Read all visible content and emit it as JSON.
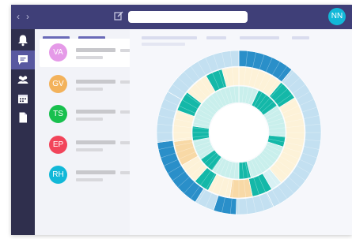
{
  "user": {
    "initials": "NN"
  },
  "chats": [
    {
      "initials": "VA",
      "color": "#e59ae8",
      "selected": true
    },
    {
      "initials": "GV",
      "color": "#f3b25b",
      "selected": false
    },
    {
      "initials": "TS",
      "color": "#18c04e",
      "selected": false
    },
    {
      "initials": "EP",
      "color": "#f2445a",
      "selected": false
    },
    {
      "initials": "RH",
      "color": "#12b8d8",
      "selected": false
    }
  ],
  "chart_data": {
    "type": "sunburst",
    "colors": {
      "dark_blue": "#2a8fc9",
      "light_blue": "#c3e0f1",
      "teal": "#14b8a8",
      "pale_teal": "#c9efec",
      "cream": "#fdf2d8",
      "gold": "#f8d9a6",
      "pale_cyan": "#d8f1f4"
    },
    "rings": [
      {
        "segments": [
          {
            "from": 0,
            "to": 40,
            "fill": "dark_blue"
          },
          {
            "from": 40,
            "to": 155,
            "fill": "light_blue"
          },
          {
            "from": 155,
            "to": 182,
            "fill": "light_blue"
          },
          {
            "from": 182,
            "to": 198,
            "fill": "dark_blue"
          },
          {
            "from": 198,
            "to": 212,
            "fill": "light_blue"
          },
          {
            "from": 212,
            "to": 263,
            "fill": "dark_blue"
          },
          {
            "from": 263,
            "to": 300,
            "fill": "light_blue"
          },
          {
            "from": 300,
            "to": 360,
            "fill": "light_blue"
          }
        ]
      },
      {
        "segments": [
          {
            "from": 0,
            "to": 40,
            "fill": "cream"
          },
          {
            "from": 40,
            "to": 58,
            "fill": "teal"
          },
          {
            "from": 58,
            "to": 140,
            "fill": "cream"
          },
          {
            "from": 140,
            "to": 150,
            "fill": "pale_cyan"
          },
          {
            "from": 150,
            "to": 168,
            "fill": "teal"
          },
          {
            "from": 168,
            "to": 188,
            "fill": "gold"
          },
          {
            "from": 188,
            "to": 208,
            "fill": "cream"
          },
          {
            "from": 208,
            "to": 222,
            "fill": "teal"
          },
          {
            "from": 222,
            "to": 240,
            "fill": "cream"
          },
          {
            "from": 240,
            "to": 262,
            "fill": "gold"
          },
          {
            "from": 262,
            "to": 290,
            "fill": "cream"
          },
          {
            "from": 290,
            "to": 308,
            "fill": "teal"
          },
          {
            "from": 308,
            "to": 330,
            "fill": "cream"
          },
          {
            "from": 330,
            "to": 345,
            "fill": "teal"
          },
          {
            "from": 345,
            "to": 360,
            "fill": "cream"
          }
        ]
      },
      {
        "segments": [
          {
            "from": 0,
            "to": 25,
            "fill": "pale_teal"
          },
          {
            "from": 25,
            "to": 55,
            "fill": "teal"
          },
          {
            "from": 55,
            "to": 95,
            "fill": "pale_teal"
          },
          {
            "from": 95,
            "to": 108,
            "fill": "teal"
          },
          {
            "from": 108,
            "to": 165,
            "fill": "pale_teal"
          },
          {
            "from": 165,
            "to": 180,
            "fill": "teal"
          },
          {
            "from": 180,
            "to": 215,
            "fill": "pale_teal"
          },
          {
            "from": 215,
            "to": 235,
            "fill": "teal"
          },
          {
            "from": 235,
            "to": 260,
            "fill": "pale_teal"
          },
          {
            "from": 260,
            "to": 278,
            "fill": "teal"
          },
          {
            "from": 278,
            "to": 360,
            "fill": "pale_teal"
          }
        ]
      }
    ]
  }
}
